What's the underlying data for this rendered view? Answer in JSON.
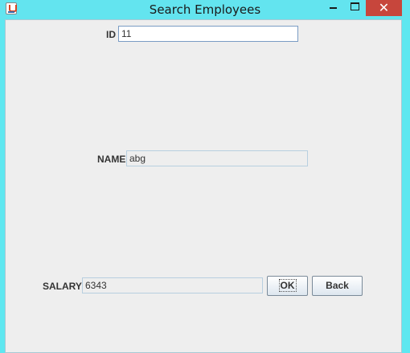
{
  "window": {
    "title": "Search Employees",
    "close_glyph": "✕"
  },
  "form": {
    "id_label": "ID",
    "id_value": "11",
    "name_label": "NAME",
    "name_value": "abg",
    "salary_label": "SALARY",
    "salary_value": "6343"
  },
  "buttons": {
    "ok_label": "OK",
    "back_label": "Back"
  },
  "icons": {
    "app": "java-coffee-cup-icon",
    "minimize": "minimize-icon",
    "maximize": "maximize-icon",
    "close": "close-icon"
  }
}
